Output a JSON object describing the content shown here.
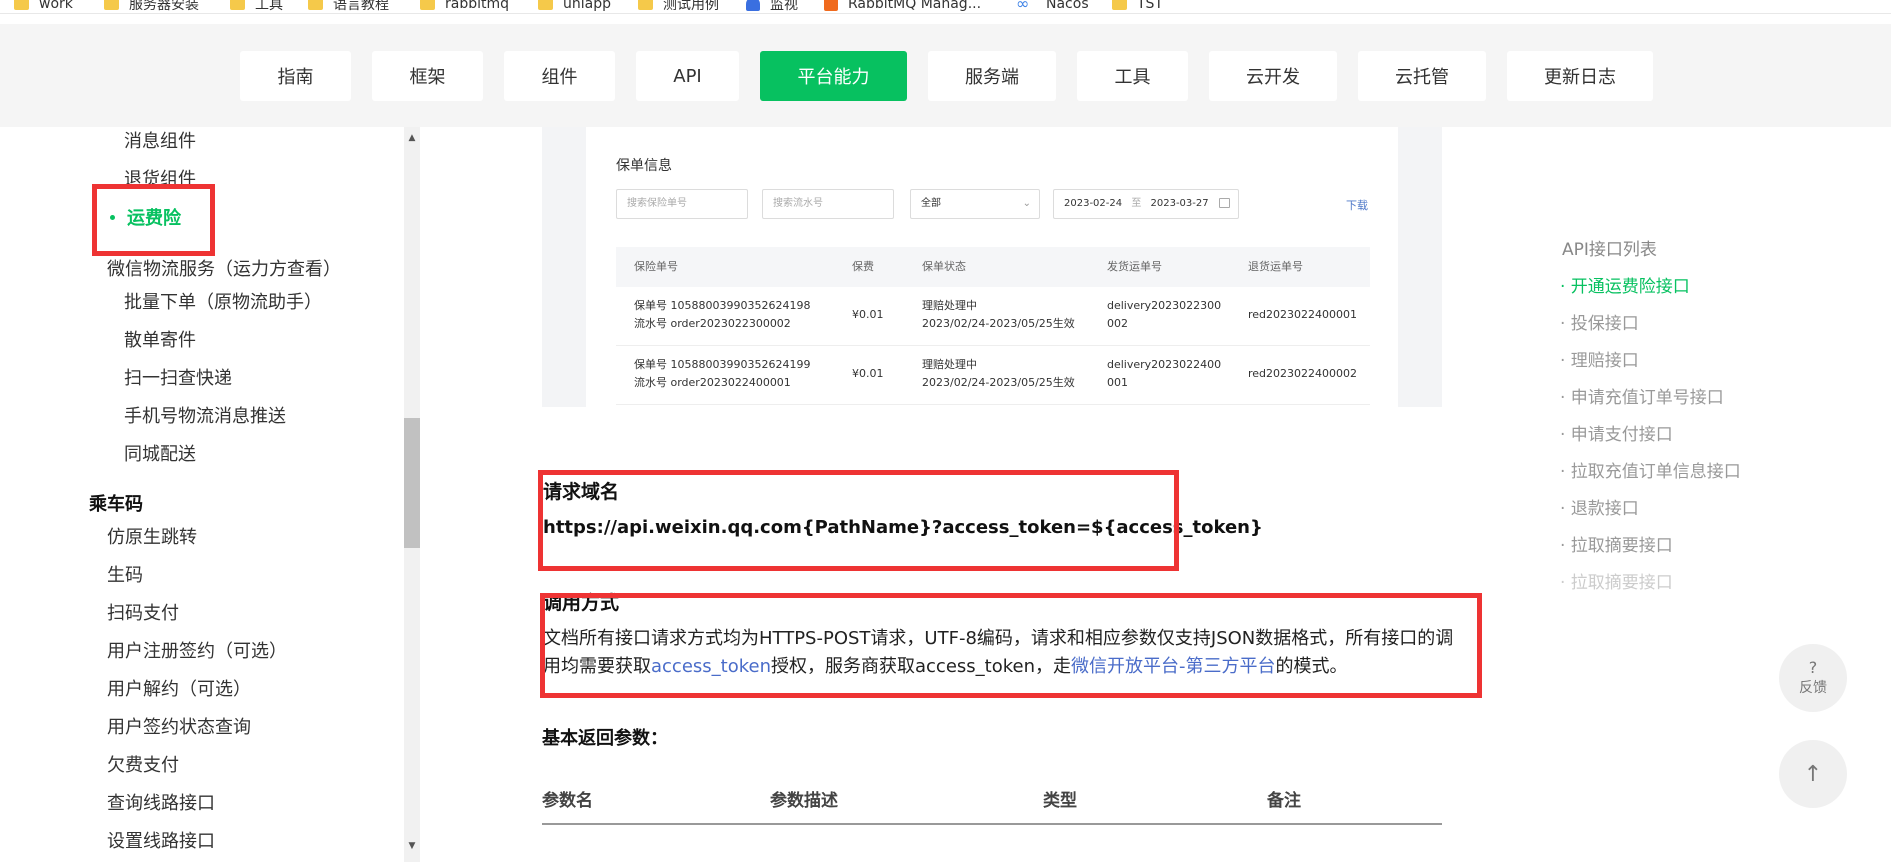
{
  "bookmarks": [
    {
      "label": "work",
      "icon": "folder-icon"
    },
    {
      "label": "服务器安装",
      "icon": "folder-icon"
    },
    {
      "label": "工具",
      "icon": "folder-icon"
    },
    {
      "label": "语言教程",
      "icon": "folder-icon"
    },
    {
      "label": "rabbitmq",
      "icon": "folder-icon"
    },
    {
      "label": "uniapp",
      "icon": "folder-icon"
    },
    {
      "label": "测试用例",
      "icon": "folder-icon"
    },
    {
      "label": "监视",
      "icon": "monitor-icon"
    },
    {
      "label": "RabbitMQ Manag...",
      "icon": "rabbitmq-icon"
    },
    {
      "label": "Nacos",
      "icon": "nacos-icon"
    },
    {
      "label": "TST",
      "icon": "folder-icon"
    }
  ],
  "topnav": {
    "items": [
      "指南",
      "框架",
      "组件",
      "API",
      "平台能力",
      "服务端",
      "工具",
      "云开发",
      "云托管",
      "更新日志"
    ],
    "active": "平台能力",
    "accent": "#07c160"
  },
  "sidebar": {
    "items": [
      {
        "label": "消息组件"
      },
      {
        "label": "退货组件"
      },
      {
        "label": "运费险",
        "active": true
      },
      {
        "label": "微信物流服务（运力方查看）"
      },
      {
        "label": "批量下单（原物流助手）"
      },
      {
        "label": "散单寄件"
      },
      {
        "label": "扫一扫查快递"
      },
      {
        "label": "手机号物流消息推送"
      },
      {
        "label": "同城配送"
      },
      {
        "label": "乘车码",
        "group": true
      },
      {
        "label": "仿原生跳转"
      },
      {
        "label": "生码"
      },
      {
        "label": "扫码支付"
      },
      {
        "label": "用户注册签约（可选）"
      },
      {
        "label": "用户解约（可选）"
      },
      {
        "label": "用户签约状态查询"
      },
      {
        "label": "欠费支付"
      },
      {
        "label": "查询线路接口"
      },
      {
        "label": "设置线路接口"
      }
    ]
  },
  "policy_card": {
    "title": "保单信息",
    "search_policy_placeholder": "搜索保险单号",
    "search_serial_placeholder": "搜索流水号",
    "status_select": "全部",
    "date_from": "2023-02-24",
    "date_sep": "至",
    "date_to": "2023-03-27",
    "download": "下载",
    "columns": [
      "保险单号",
      "保费",
      "保单状态",
      "发货运单号",
      "退货运单号"
    ],
    "rows": [
      {
        "policy_no": "保单号 10588003990352624198",
        "serial_no": "流水号 order2023022300002",
        "premium": "¥0.01",
        "status": "理赔处理中",
        "period": "2023/02/24-2023/05/25生效",
        "delivery_a": "delivery2023022300",
        "delivery_b": "002",
        "return_no": "red2023022400001"
      },
      {
        "policy_no": "保单号 10588003990352624199",
        "serial_no": "流水号 order2023022400001",
        "premium": "¥0.01",
        "status": "理赔处理中",
        "period": "2023/02/24-2023/05/25生效",
        "delivery_a": "delivery2023022400",
        "delivery_b": "001",
        "return_no": "red2023022400002"
      }
    ]
  },
  "content": {
    "domain_title": "请求域名",
    "domain_url": "https://api.weixin.qq.com{PathName}?access_token=${access_token}",
    "method_title": "调用方式",
    "method_text_1": "文档所有接口请求方式均为HTTPS-POST请求，UTF-8编码，请求和相应参数仅支持JSON数据格式，所有接口的调",
    "method_text_2a": "用均需要获取",
    "method_link_1": "access_token",
    "method_text_2b": "授权，服务商获取access_token，走",
    "method_link_2": "微信开放平台-第三方平台",
    "method_text_2c": "的模式。",
    "params_title": "基本返回参数：",
    "param_columns": [
      "参数名",
      "参数描述",
      "类型",
      "备注"
    ]
  },
  "toc": {
    "title": "API接口列表",
    "items": [
      {
        "label": "· 开通运费险接口",
        "active": true
      },
      {
        "label": "· 投保接口"
      },
      {
        "label": "· 理赔接口"
      },
      {
        "label": "· 申请充值订单号接口"
      },
      {
        "label": "· 申请支付接口"
      },
      {
        "label": "· 拉取充值订单信息接口"
      },
      {
        "label": "· 退款接口"
      },
      {
        "label": "· 拉取摘要接口"
      },
      {
        "label": "· 拉取摘要接口"
      }
    ]
  },
  "floating": {
    "feedback_label": "反馈",
    "feedback_icon": "?",
    "top_icon": "↑"
  }
}
